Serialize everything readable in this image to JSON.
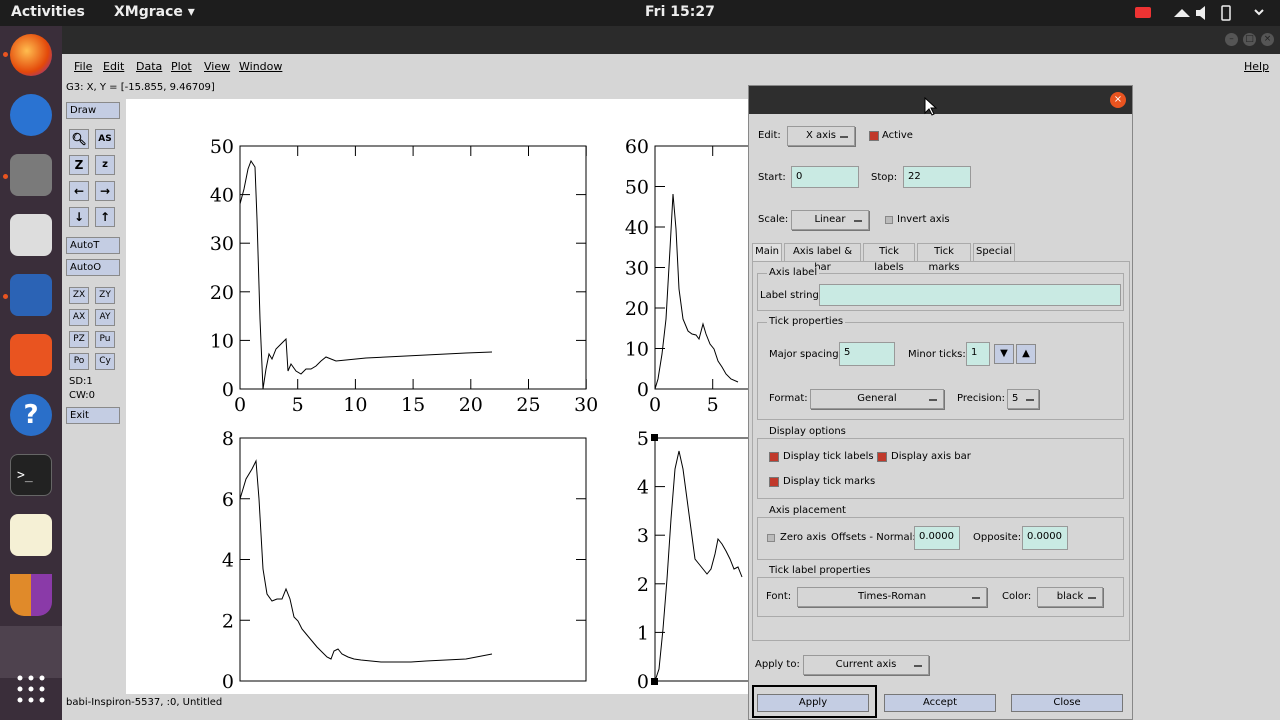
{
  "topbar": {
    "activities": "Activities",
    "app_name": "XMgrace ▾",
    "clock": "Fri 15:27"
  },
  "menu": {
    "file": "File",
    "edit": "Edit",
    "data": "Data",
    "plot": "Plot",
    "view": "View",
    "window": "Window",
    "help": "Help"
  },
  "coords": "G3: X, Y = [-15.855, 9.46709]",
  "leftpanel": {
    "draw": "Draw",
    "autot": "AutoT",
    "autoo": "AutoO",
    "zx": "ZX",
    "zy": "ZY",
    "ax": "AX",
    "ay": "AY",
    "pz": "PZ",
    "pu": "Pu",
    "po": "Po",
    "cy": "Cy",
    "sd": "SD:1",
    "cw": "CW:0",
    "exit": "Exit"
  },
  "statusbar": "babi-Inspiron-5537, :0, Untitled",
  "graphs": {
    "g0_yticks": [
      "50",
      "40",
      "30",
      "20",
      "10",
      "0"
    ],
    "g0_xticks": [
      "0",
      "5",
      "10",
      "15",
      "20",
      "25",
      "30"
    ],
    "g1_yticks": [
      "60",
      "50",
      "40",
      "30",
      "20",
      "10",
      "0"
    ],
    "g1_xticks": [
      "0",
      "5"
    ],
    "g2_yticks": [
      "8",
      "6",
      "4",
      "2",
      "0"
    ],
    "g3_yticks": [
      "5",
      "4",
      "3",
      "2",
      "1",
      "0"
    ]
  },
  "dialog": {
    "edit_label": "Edit:",
    "edit_value": "X axis",
    "active_label": "Active",
    "start_label": "Start:",
    "start_value": "0",
    "stop_label": "Stop:",
    "stop_value": "22",
    "scale_label": "Scale:",
    "scale_value": "Linear",
    "invert_label": "Invert axis",
    "tabs": [
      "Main",
      "Axis label & bar",
      "Tick labels",
      "Tick marks",
      "Special"
    ],
    "axis_label_title": "Axis label",
    "label_string": "Label string:",
    "label_value": "",
    "tick_props_title": "Tick properties",
    "major_label": "Major spacing:",
    "major_value": "5",
    "minor_label": "Minor ticks:",
    "minor_value": "1",
    "format_label": "Format:",
    "format_value": "General",
    "precision_label": "Precision:",
    "precision_value": "5",
    "display_title": "Display options",
    "disp_ticklabels": "Display tick labels",
    "disp_axisbar": "Display axis bar",
    "disp_tickmarks": "Display tick marks",
    "placement_title": "Axis placement",
    "zero_axis": "Zero axis",
    "offsets_label": "Offsets - Normal:",
    "normal_value": "0.0000",
    "opposite_label": "Opposite:",
    "opposite_value": "0.0000",
    "ticklabel_title": "Tick label properties",
    "font_label": "Font:",
    "font_value": "Times-Roman",
    "color_label": "Color:",
    "color_value": "black",
    "apply_to_label": "Apply to:",
    "apply_to_value": "Current axis",
    "apply": "Apply",
    "accept": "Accept",
    "close": "Close"
  }
}
